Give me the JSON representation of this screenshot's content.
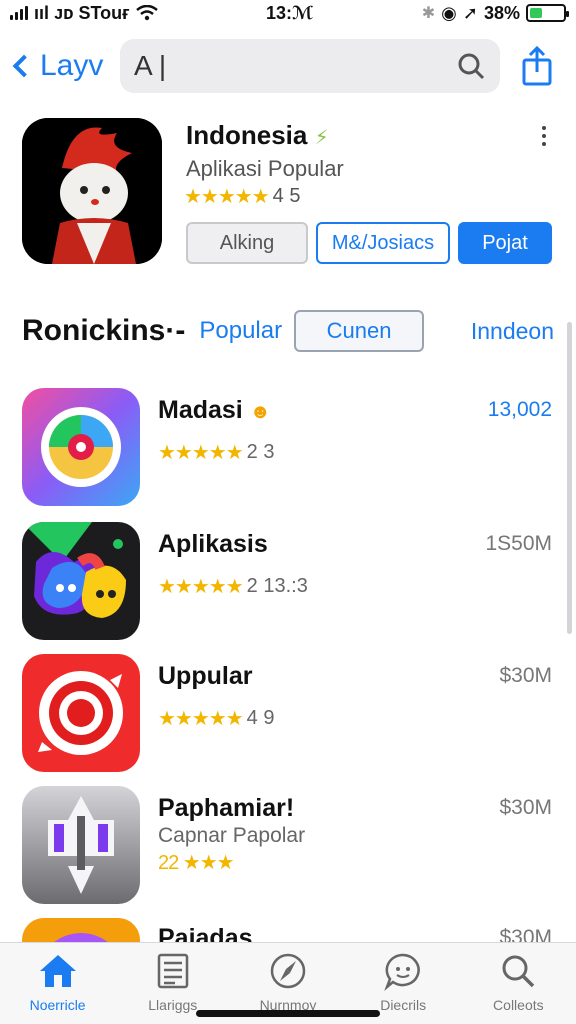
{
  "status_bar": {
    "carrier": "ııl ᴊᴅ STouғ",
    "time": "13:ℳ",
    "battery": "38%",
    "battery_level": 0.38
  },
  "nav": {
    "back_label": "Layv",
    "search_value": "A |"
  },
  "featured": {
    "title": "Indonesia",
    "subtitle": "Aplikasi Popular",
    "stars": "★★★★★",
    "rating": "4 5",
    "buttons": [
      "Alking",
      "M&/Josiacs",
      "Pojat"
    ]
  },
  "section": {
    "title": "Ronickins·-",
    "tab_popular": "Popular",
    "tab_current": "Cunen",
    "tab_indo": "Inndeon"
  },
  "apps": [
    {
      "name": "Madasi",
      "stars": "★★★★★",
      "rating": "2 3",
      "price": "13,002",
      "price_color": "blue",
      "colors": [
        "#f04d8c",
        "#8b5cf6",
        "#3ba7f5",
        "#f5c542"
      ]
    },
    {
      "name": "Aplikasis",
      "stars": "★★★★★",
      "rating": "2 13.:3",
      "price": "1S50M",
      "colors": [
        "#22c55e",
        "#6d28d9",
        "#ef4444",
        "#facc15"
      ]
    },
    {
      "name": "Uppular",
      "stars": "★★★★★",
      "rating": "4 9",
      "price": "$30M",
      "colors": [
        "#ef2b2b",
        "#e11d1d",
        "#ffffff",
        "#ef2b2b"
      ]
    },
    {
      "name": "Paphamiar!",
      "subtitle": "Capnar Papolar",
      "stars": "22 ★★★",
      "rating": "",
      "price": "$30M",
      "colors": [
        "#a3a3a8",
        "#e5e5e7",
        "#7c3aed",
        "#d4d4d8"
      ]
    },
    {
      "name": "Paiadas",
      "stars": "",
      "rating": "",
      "price": "$30M",
      "colors": [
        "#f59e0b",
        "#a855f7",
        "#ec4899",
        "#f59e0b"
      ]
    }
  ],
  "tabs": [
    {
      "label": "Noerricle",
      "icon": "home-icon",
      "active": true
    },
    {
      "label": "Llariggs",
      "icon": "list-icon",
      "active": false
    },
    {
      "label": "Nurnmoy",
      "icon": "compass-icon",
      "active": false
    },
    {
      "label": "Diecrils",
      "icon": "chat-icon",
      "active": false
    },
    {
      "label": "Colleots",
      "icon": "search-icon",
      "active": false
    }
  ]
}
